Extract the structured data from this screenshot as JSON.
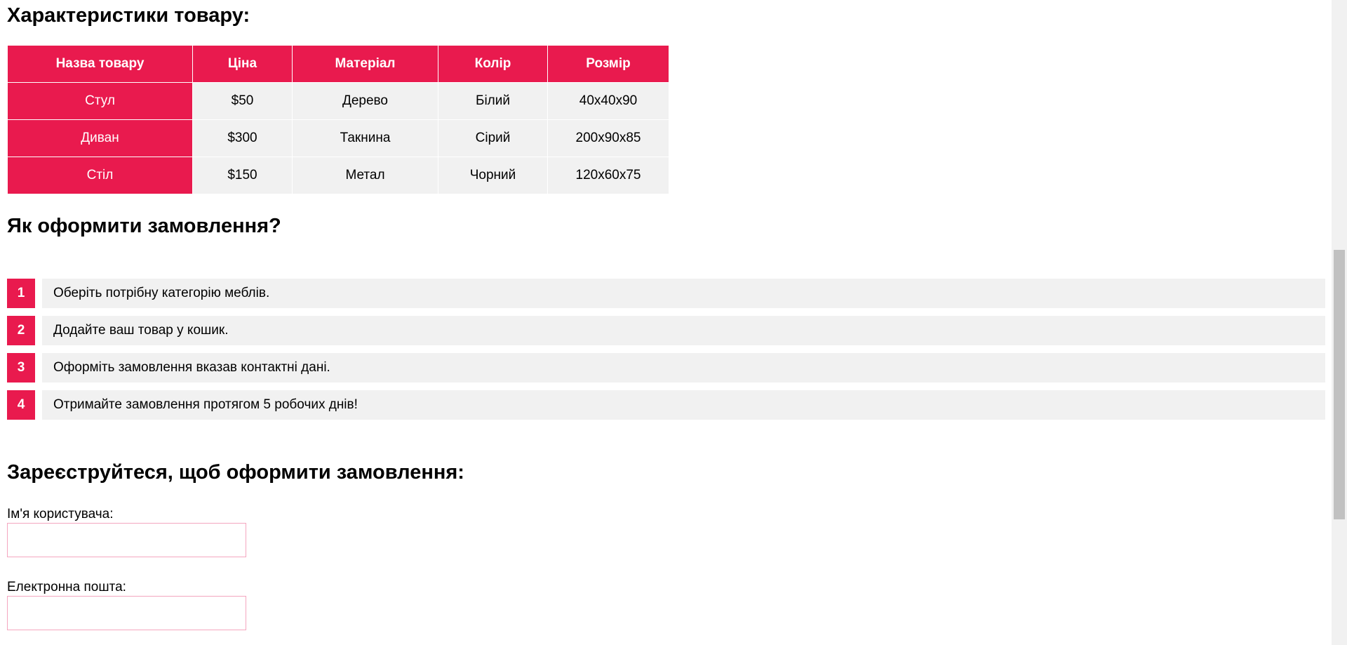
{
  "specs": {
    "title": "Характеристики товару:",
    "headers": [
      "Назва товару",
      "Ціна",
      "Матеріал",
      "Колір",
      "Розмір"
    ],
    "rows": [
      [
        "Стул",
        "$50",
        "Дерево",
        "Білий",
        "40x40x90"
      ],
      [
        "Диван",
        "$300",
        "Такнина",
        "Сірий",
        "200x90x85"
      ],
      [
        "Стіл",
        "$150",
        "Метал",
        "Чорний",
        "120x60x75"
      ]
    ]
  },
  "order": {
    "title": "Як оформити замовлення?",
    "steps": [
      {
        "num": "1",
        "text": "Оберіть потрібну категорію меблів."
      },
      {
        "num": "2",
        "text": "Додайте ваш товар у кошик."
      },
      {
        "num": "3",
        "text": "Оформіть замовлення вказав контактні дані."
      },
      {
        "num": "4",
        "text": "Отримайте замовлення протягом 5 робочих днів!"
      }
    ]
  },
  "register": {
    "title": "Зареєструйтеся, щоб оформити замовлення:",
    "username_label": "Ім'я користувача:",
    "username_value": "",
    "email_label": "Електронна пошта:",
    "email_value": ""
  },
  "colors": {
    "accent": "#e91a4e",
    "cell_bg": "#f1f1f1",
    "input_border": "#f4a6bf"
  }
}
